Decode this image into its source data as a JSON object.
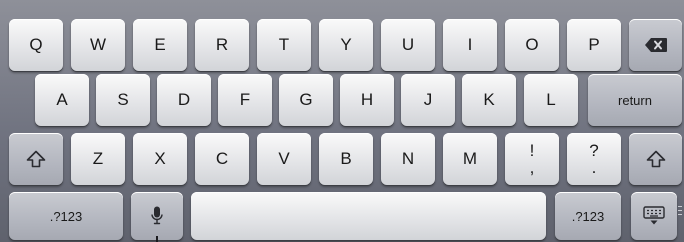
{
  "keyboard": {
    "row1": [
      "Q",
      "W",
      "E",
      "R",
      "T",
      "Y",
      "U",
      "I",
      "O",
      "P"
    ],
    "row2": [
      "A",
      "S",
      "D",
      "F",
      "G",
      "H",
      "J",
      "K",
      "L"
    ],
    "row3": [
      "Z",
      "X",
      "C",
      "V",
      "B",
      "N",
      "M"
    ],
    "punct_top": [
      "!",
      "?"
    ],
    "punct_bottom": [
      ",",
      "."
    ],
    "return_label": "return",
    "numbers_label_left": ".?123",
    "numbers_label_right": ".?123",
    "icons": {
      "backspace": "backspace-icon",
      "shift": "shift-icon",
      "mic": "microphone-icon",
      "hide_keyboard": "hide-keyboard-icon"
    },
    "colors": {
      "background": "#6f727e",
      "key_light": "#ebebee",
      "key_dark": "#b3b6bf",
      "label": "#1a1a1a"
    }
  }
}
